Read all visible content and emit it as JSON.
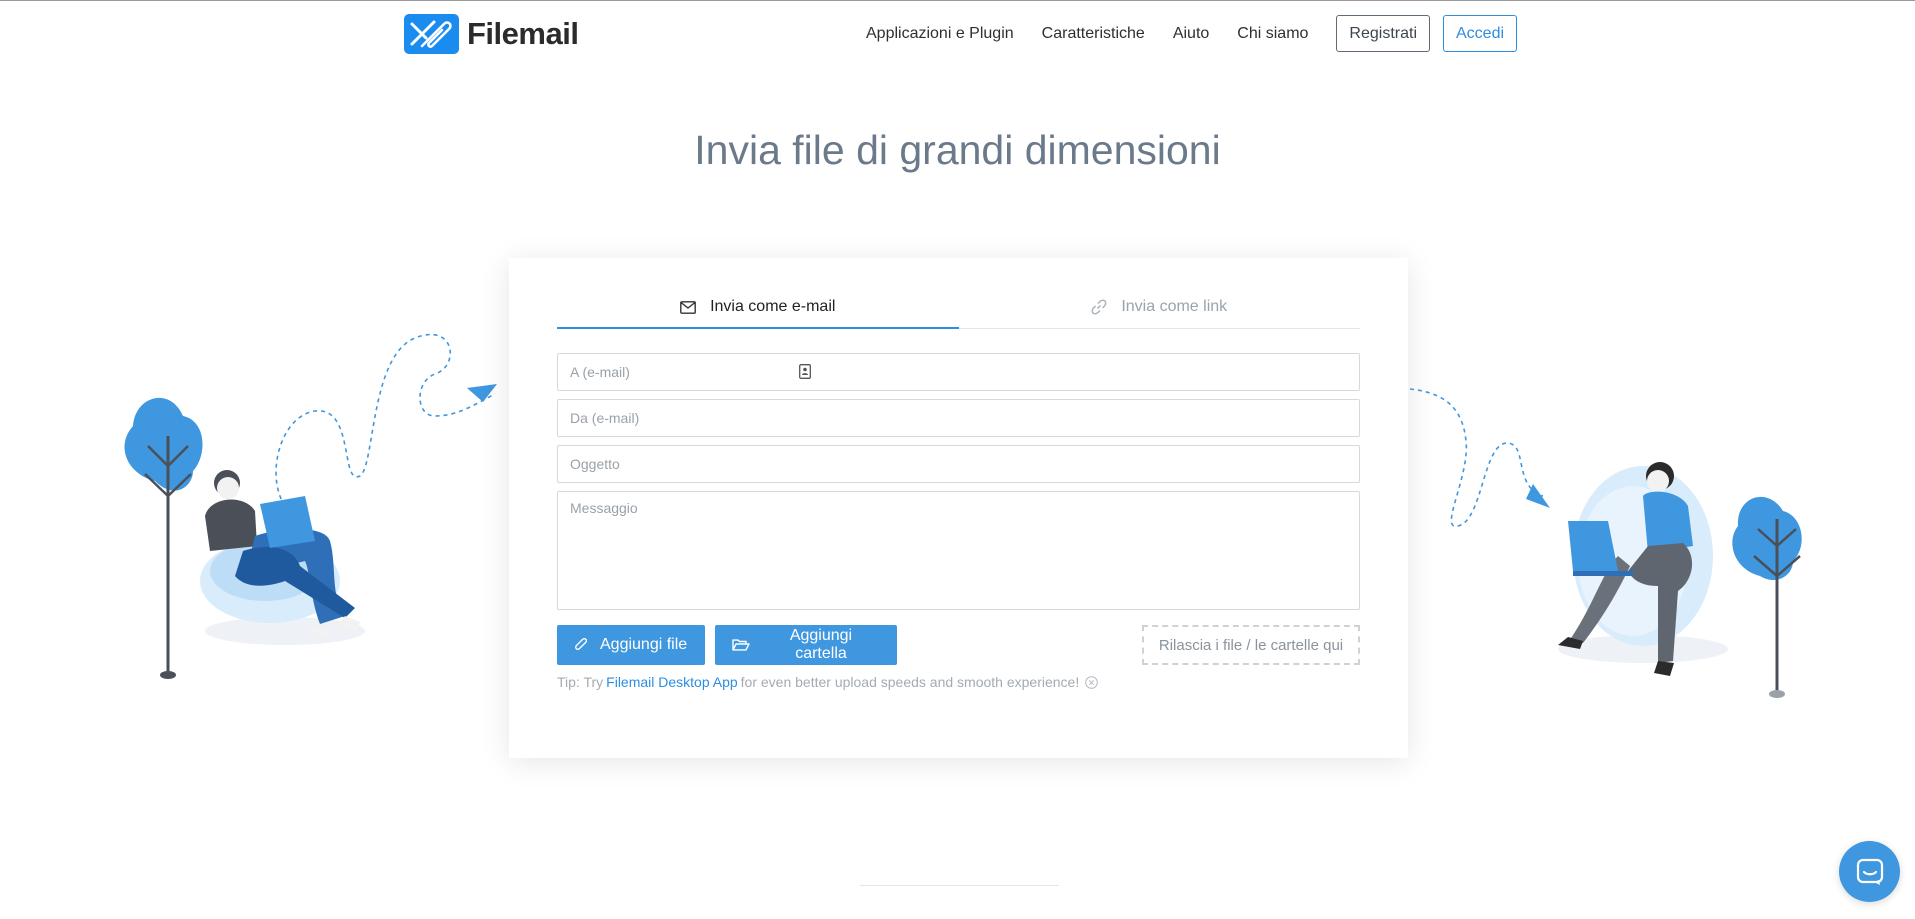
{
  "brand": {
    "name": "Filemail",
    "accent": "#1a8cf0"
  },
  "nav": {
    "links": [
      "Applicazioni e Plugin",
      "Caratteristiche",
      "Aiuto",
      "Chi siamo"
    ],
    "register_label": "Registrati",
    "login_label": "Accedi"
  },
  "page": {
    "title": "Invia file di grandi dimensioni"
  },
  "tabs": [
    {
      "label": "Invia come e-mail",
      "icon": "envelope-icon",
      "active": true
    },
    {
      "label": "Invia come link",
      "icon": "link-icon",
      "active": false
    }
  ],
  "form": {
    "to_placeholder": "A (e-mail)",
    "from_placeholder": "Da (e-mail)",
    "subject_placeholder": "Oggetto",
    "message_placeholder": "Messaggio",
    "add_file_label": "Aggiungi file",
    "add_folder_label": "Aggiungi cartella",
    "dropzone_label": "Rilascia i file / le cartelle qui"
  },
  "tip": {
    "prefix": "Tip: Try",
    "link": "Filemail Desktop App",
    "suffix": "for even better upload speeds and smooth experience!"
  },
  "colors": {
    "primary_button": "#3f97e0",
    "title": "#6b7a8a",
    "illustration_blue": "#3f97e0"
  }
}
